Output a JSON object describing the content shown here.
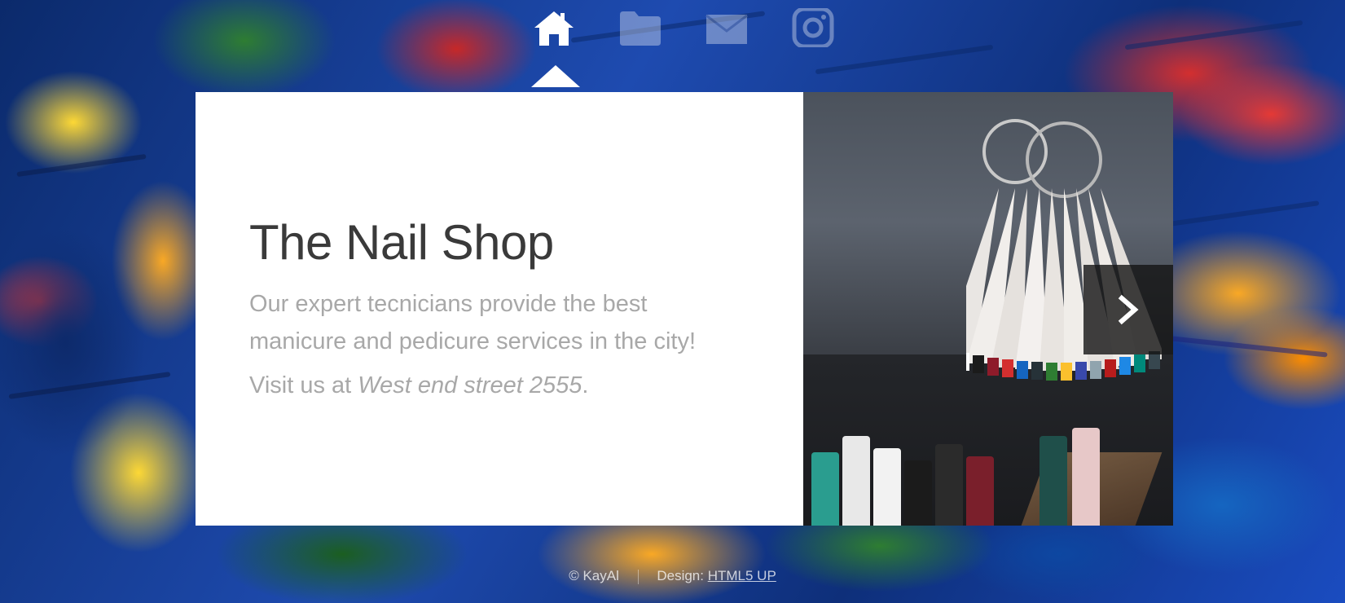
{
  "nav": {
    "items": [
      {
        "icon": "home-icon",
        "active": true
      },
      {
        "icon": "folder-icon",
        "active": false
      },
      {
        "icon": "envelope-icon",
        "active": false
      },
      {
        "icon": "instagram-icon",
        "active": false
      }
    ]
  },
  "intro": {
    "title": "The Nail Shop",
    "description": "Our expert tecnicians provide the best manicure and pedicure services in the city!",
    "visit_prefix": "Visit us at ",
    "address": "West end street 2555",
    "visit_suffix": "."
  },
  "image": {
    "next_icon": "chevron-right-icon"
  },
  "footer": {
    "copyright": "© KayAl",
    "design_label": "Design: ",
    "design_link": "HTML5 UP"
  },
  "colors": {
    "panel_bg": "#ffffff",
    "title": "#3a3a3a",
    "text": "#a8a8a8"
  }
}
